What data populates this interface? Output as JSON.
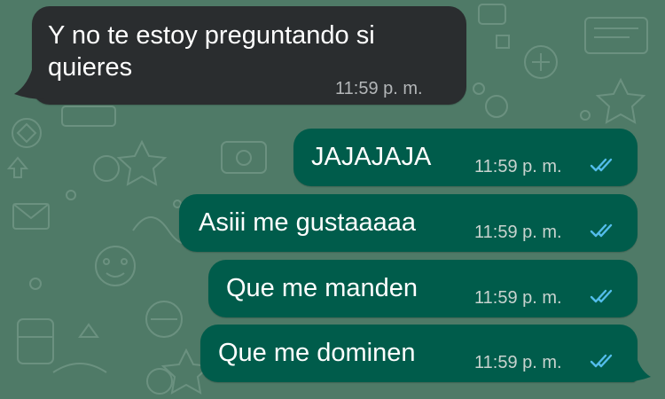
{
  "colors": {
    "chat_background": "#4f7a67",
    "incoming_bubble": "#2a2d2f",
    "outgoing_bubble": "#005c4b",
    "read_ticks": "#53bdeb"
  },
  "icons": {
    "read_receipt": "double-check-icon"
  },
  "messages": [
    {
      "direction": "incoming",
      "text": "Y no te estoy preguntando si\nquieres",
      "time": "11:59 p. m."
    },
    {
      "direction": "outgoing",
      "text": "JAJAJAJA",
      "time": "11:59 p. m.",
      "status": "read"
    },
    {
      "direction": "outgoing",
      "text": "Asiii me gustaaaaa",
      "time": "11:59 p. m.",
      "status": "read"
    },
    {
      "direction": "outgoing",
      "text": "Que me manden",
      "time": "11:59 p. m.",
      "status": "read"
    },
    {
      "direction": "outgoing",
      "text": "Que me dominen",
      "time": "11:59 p. m.",
      "status": "read"
    }
  ]
}
